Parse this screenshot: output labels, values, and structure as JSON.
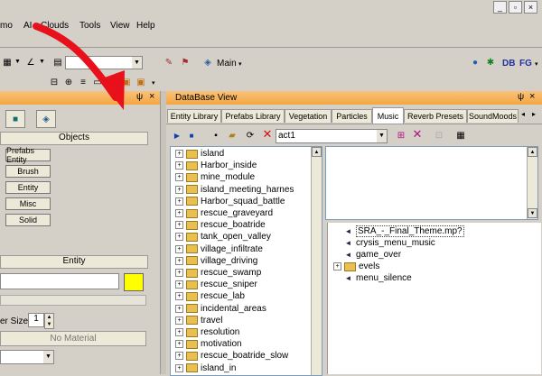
{
  "menu": {
    "items": [
      "mo",
      "AI",
      "Clouds",
      "Tools",
      "View",
      "Help"
    ]
  },
  "window_controls": [
    "_",
    "▫",
    "×"
  ],
  "toolbar": {
    "layer_value": "",
    "main_label": "Main",
    "db_label": "DB",
    "fg_label": "FG"
  },
  "left_panel": {
    "pin": "ψ",
    "close": "×",
    "objects_header": "Objects",
    "buttons": [
      "Prefabs Entity",
      "Brush",
      "Entity",
      "Misc",
      "Solid"
    ],
    "entity_header": "Entity",
    "size_label": "er Size:",
    "size_value": "1",
    "material_button": "No Material"
  },
  "database": {
    "title": "DataBase View",
    "tabs": [
      "Entity Library",
      "Prefabs Library",
      "Vegetation",
      "Particles",
      "Music",
      "Reverb Presets",
      "SoundMoods"
    ],
    "active_tab": "Music",
    "combo_value": "act1",
    "library_items": [
      "island",
      "Harbor_inside",
      "mine_module",
      "island_meeting_harnes",
      "Harbor_squad_battle",
      "rescue_graveyard",
      "rescue_boatride",
      "tank_open_valley",
      "village_infiltrate",
      "village_driving",
      "rescue_swamp",
      "rescue_sniper",
      "rescue_lab",
      "incidental_areas",
      "travel",
      "resolution",
      "motivation",
      "rescue_boatride_slow",
      "island_in"
    ],
    "theme_items": [
      {
        "label": "SRA_-_Final_Theme.mp?",
        "kind": "sound",
        "expand": false,
        "selected": true
      },
      {
        "label": "crysis_menu_music",
        "kind": "sound",
        "expand": false,
        "selected": false
      },
      {
        "label": "game_over",
        "kind": "sound",
        "expand": false,
        "selected": false
      },
      {
        "label": "evels",
        "kind": "folder",
        "expand": true,
        "selected": false
      },
      {
        "label": "menu_silence",
        "kind": "sound",
        "expand": false,
        "selected": false
      }
    ]
  },
  "colors": {
    "accent_orange": "#f4a640",
    "yellow_swatch": "#ffff00",
    "arrow_red": "#e8101a"
  }
}
